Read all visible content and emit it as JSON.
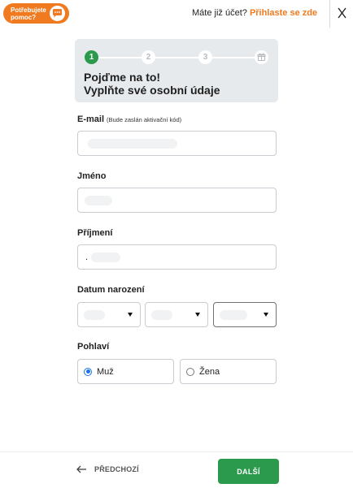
{
  "header": {
    "help_label": "Potřebujete pomoc?",
    "login_question": "Máte již účet?",
    "login_link": "Přihlaste se zde",
    "close_glyph": "×"
  },
  "steps": {
    "items": [
      "1",
      "2",
      "3",
      "gift-icon"
    ],
    "current": 1,
    "title_line1": "Pojďme na to!",
    "title_line2": "Vyplňte své osobní údaje"
  },
  "form": {
    "email": {
      "label": "E-mail",
      "hint": "(Bude zaslán aktivační kód)",
      "value": ""
    },
    "first_name": {
      "label": "Jméno",
      "value": ""
    },
    "last_name": {
      "label": "Příjmení",
      "value": "."
    },
    "birthdate": {
      "label": "Datum narození"
    },
    "gender": {
      "label": "Pohlaví",
      "options": [
        "Muž",
        "Žena"
      ],
      "selected": "Muž"
    }
  },
  "footer": {
    "back_label": "PŘEDCHOZÍ",
    "next_label": "DALŠÍ"
  },
  "colors": {
    "accent_orange": "#ef7a1f",
    "primary_green": "#2c9a4c",
    "radio_blue": "#1a73e8"
  }
}
